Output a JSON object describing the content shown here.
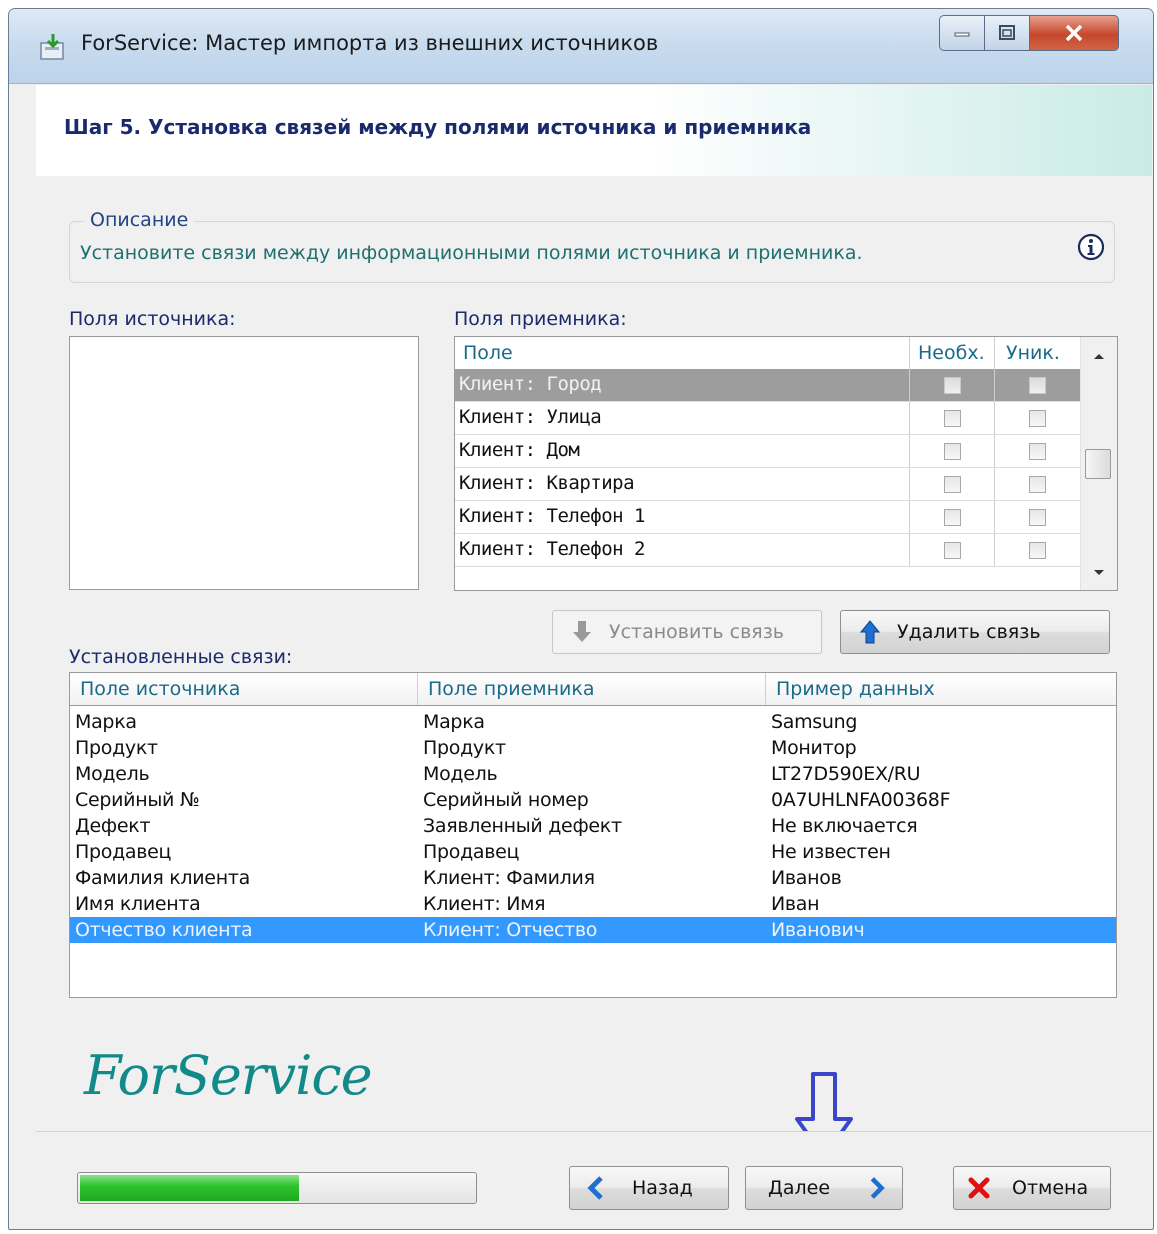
{
  "window": {
    "title": "ForService: Мастер импорта из внешних источников",
    "min_icon": "minimize-icon",
    "max_icon": "maximize-icon",
    "close_icon": "close-icon"
  },
  "header": {
    "step_title": "Шаг 5. Установка связей между полями источника и приемника"
  },
  "description": {
    "legend": "Описание",
    "text": "Установите связи между информационными полями источника и приемника.",
    "icon": "info-icon"
  },
  "source_fields": {
    "label": "Поля источника:",
    "items": []
  },
  "target_fields": {
    "label": "Поля приемника:",
    "columns": [
      "Поле",
      "Необх.",
      "Уник."
    ],
    "rows": [
      {
        "name": "Клиент: Город",
        "required": false,
        "unique": false,
        "selected": true
      },
      {
        "name": "Клиент: Улица",
        "required": false,
        "unique": false,
        "selected": false
      },
      {
        "name": "Клиент: Дом",
        "required": false,
        "unique": false,
        "selected": false
      },
      {
        "name": "Клиент: Квартира",
        "required": false,
        "unique": false,
        "selected": false
      },
      {
        "name": "Клиент: Телефон 1",
        "required": false,
        "unique": false,
        "selected": false
      },
      {
        "name": "Клиент: Телефон 2",
        "required": false,
        "unique": false,
        "selected": false
      }
    ]
  },
  "actions": {
    "link_label": "Установить связь",
    "link_enabled": false,
    "unlink_label": "Удалить связь"
  },
  "links": {
    "label": "Установленные связи:",
    "columns": [
      "Поле источника",
      "Поле приемника",
      "Пример данных"
    ],
    "rows": [
      [
        "Марка",
        "Марка",
        "Samsung"
      ],
      [
        "Продукт",
        "Продукт",
        "Монитор"
      ],
      [
        "Модель",
        "Модель",
        "LT27D590EX/RU"
      ],
      [
        "Серийный №",
        "Серийный номер",
        "0A7UHLNFA00368F"
      ],
      [
        "Дефект",
        "Заявленный дефект",
        "Не включается"
      ],
      [
        "Продавец",
        "Продавец",
        "Не известен"
      ],
      [
        "Фамилия клиента",
        "Клиент: Фамилия",
        "Иванов"
      ],
      [
        "Имя клиента",
        "Клиент: Имя",
        "Иван"
      ],
      [
        "Отчество клиента",
        "Клиент: Отчество",
        "Иванович"
      ]
    ],
    "selected_index": 8
  },
  "logo": "ForService",
  "footer": {
    "progress": 0.56,
    "back_label": "Назад",
    "next_label": "Далее",
    "cancel_label": "Отмена"
  },
  "colors": {
    "accent": "#3399ff",
    "title_text": "#1a2a6c",
    "logo": "#128a8a",
    "progress": "#2fc52f",
    "cancel_x": "#e01010",
    "arrow_blue": "#1e6fd0"
  }
}
